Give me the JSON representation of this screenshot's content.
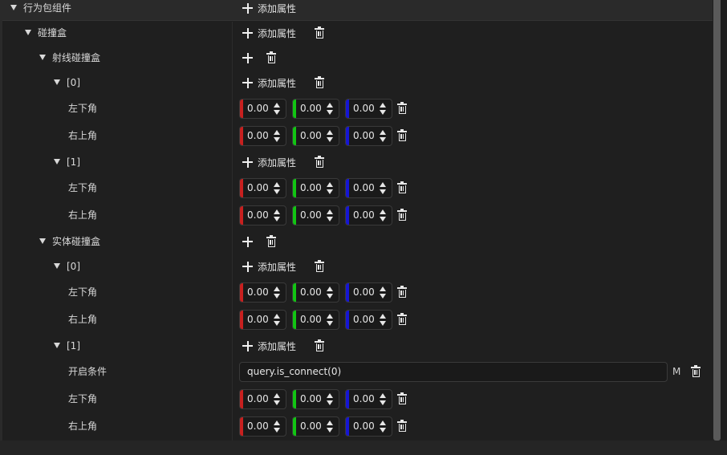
{
  "labels": {
    "add_property": "添加属性",
    "x_value": "0.00",
    "y_value": "0.00",
    "z_value": "0.00",
    "m_button": "M"
  },
  "tree": {
    "behavior_pack_component": "行为包组件",
    "collision_box": "碰撞盒",
    "ray_collision_box": "射线碰撞盒",
    "entity_collision_box": "实体碰撞盒",
    "index_0": "[0]",
    "index_1": "[1]",
    "bottom_left_corner": "左下角",
    "top_right_corner": "右上角",
    "enable_condition": "开启条件"
  },
  "fields": {
    "enable_condition_value": "query.is_connect(0)"
  },
  "axis_colors": {
    "x": "#c8201f",
    "y": "#12c513",
    "z": "#1616d4"
  },
  "icons": {
    "expand": "triangle-down-icon",
    "add": "plus-icon",
    "delete": "trash-icon",
    "spinner": "up-down-arrows-icon"
  }
}
